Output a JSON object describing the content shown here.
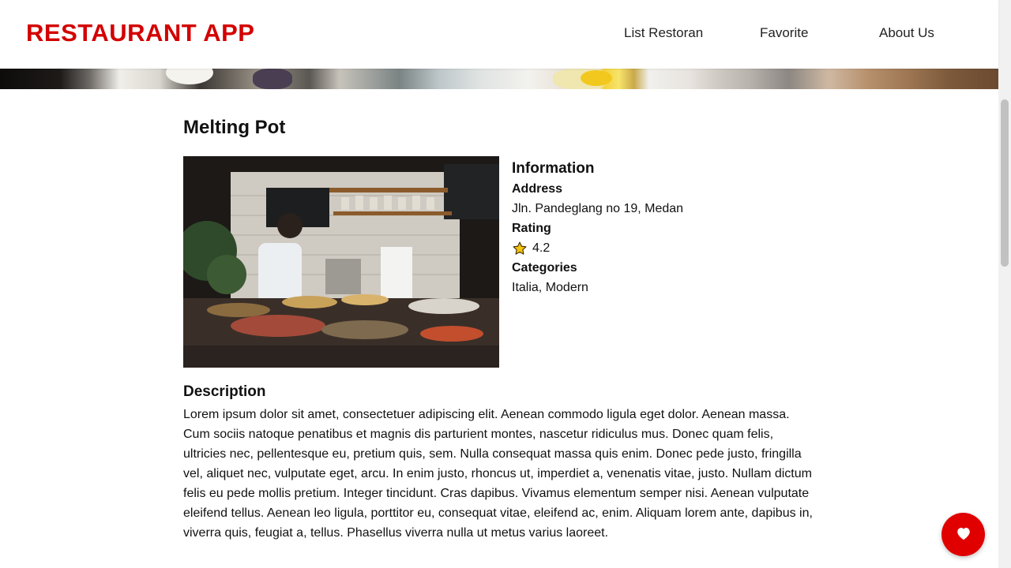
{
  "header": {
    "brand": "RESTAURANT APP",
    "nav": [
      {
        "label": "List Restoran"
      },
      {
        "label": "Favorite"
      },
      {
        "label": "About Us"
      }
    ]
  },
  "restaurant": {
    "name": "Melting Pot",
    "photo_icon": "restaurant-kitchen-photo",
    "info": {
      "heading": "Information",
      "address_label": "Address",
      "address": "Jln. Pandeglang no 19, Medan",
      "rating_label": "Rating",
      "rating_icon": "star-icon",
      "rating": "4.2",
      "categories_label": "Categories",
      "categories": "Italia, Modern"
    },
    "description_heading": "Description",
    "description": "Lorem ipsum dolor sit amet, consectetuer adipiscing elit. Aenean commodo ligula eget dolor. Aenean massa. Cum sociis natoque penatibus et magnis dis parturient montes, nascetur ridiculus mus. Donec quam felis, ultricies nec, pellentesque eu, pretium quis, sem. Nulla consequat massa quis enim. Donec pede justo, fringilla vel, aliquet nec, vulputate eget, arcu. In enim justo, rhoncus ut, imperdiet a, venenatis vitae, justo. Nullam dictum felis eu pede mollis pretium. Integer tincidunt. Cras dapibus. Vivamus elementum semper nisi. Aenean vulputate eleifend tellus. Aenean leo ligula, porttitor eu, consequat vitae, eleifend ac, enim. Aliquam lorem ante, dapibus in, viverra quis, feugiat a, tellus. Phasellus viverra nulla ut metus varius laoreet."
  },
  "favorite_button": {
    "icon": "heart-icon"
  },
  "colors": {
    "brand": "#d30000",
    "fab": "#e00000",
    "star": "#f4c20d"
  }
}
